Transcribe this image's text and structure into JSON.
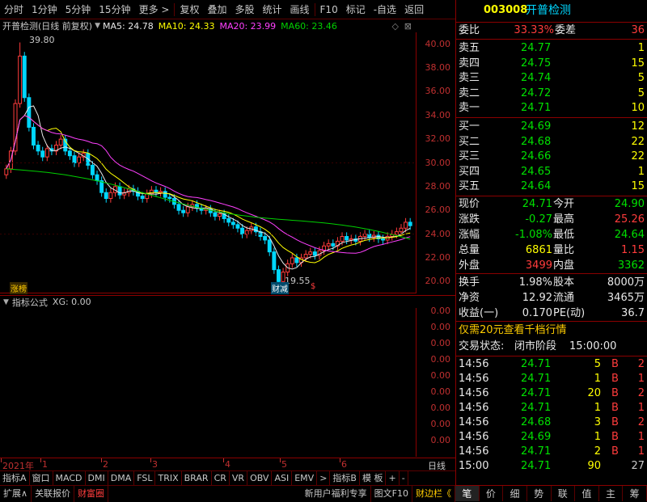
{
  "toolbar": {
    "items": [
      "分时",
      "1分钟",
      "5分钟",
      "15分钟",
      "更多 >",
      "复权",
      "叠加",
      "多股",
      "统计",
      "画线",
      "F10",
      "标记",
      "-自选",
      "返回"
    ]
  },
  "chart": {
    "stock_name": "开普检测",
    "mode": "(日线 前复权)",
    "ma5": "MA5: 24.78",
    "ma10": "MA10: 24.33",
    "ma20": "MA20: 23.99",
    "ma60": "MA60: 23.46",
    "high_mark": "39.80",
    "low_mark": "19.55",
    "tag_left": "涨榜",
    "tag_mid": "财减",
    "tag_s": "$"
  },
  "colors": {
    "ma5": "#e8e8e8",
    "ma10": "#ffff00",
    "ma20": "#ff40ff",
    "ma60": "#00d000",
    "up": "#ff3c3c",
    "down": "#00d7ff"
  },
  "chart_data": {
    "type": "candlestick",
    "ylim": [
      19,
      41
    ],
    "yticks": [
      "40.00",
      "38.00",
      "36.00",
      "34.00",
      "32.00",
      "30.00",
      "28.00",
      "26.00",
      "24.00",
      "22.00",
      "20.00"
    ],
    "close": [
      29.5,
      31.0,
      35.0,
      39.0,
      35.5,
      33.0,
      31.5,
      31.0,
      30.5,
      31.2,
      31.0,
      31.5,
      32.0,
      31.0,
      30.6,
      30.0,
      30.5,
      30.8,
      29.8,
      29.0,
      28.5,
      27.5,
      27.0,
      27.5,
      28.0,
      27.3,
      27.5,
      27.8,
      27.6,
      27.2,
      27.0,
      27.4,
      27.7,
      27.5,
      27.6,
      27.1,
      27.0,
      26.5,
      26.0,
      25.8,
      26.3,
      26.5,
      26.2,
      26.0,
      26.1,
      25.8,
      25.5,
      25.7,
      25.3,
      25.0,
      24.8,
      24.5,
      24.0,
      24.3,
      24.6,
      24.2,
      23.8,
      23.5,
      22.5,
      21.0,
      20.0,
      20.8,
      21.5,
      22.0,
      21.6,
      22.0,
      22.3,
      22.5,
      22.2,
      22.6,
      23.0,
      23.2,
      23.0,
      23.4,
      23.8,
      23.5,
      23.6,
      23.4,
      23.8,
      24.0,
      23.7,
      23.9,
      23.6,
      23.5,
      23.8,
      24.0,
      24.2,
      24.5,
      25.0,
      24.71
    ],
    "ma_last": {
      "ma5": 24.78,
      "ma10": 24.33,
      "ma20": 23.99,
      "ma60": 23.46
    }
  },
  "indicator": {
    "title": "指标公式",
    "xg": "XG: 0.00",
    "ticks": [
      "0.00",
      "0.00",
      "0.00",
      "0.00",
      "0.00",
      "0.00",
      "0.00",
      "0.00",
      "0.00"
    ]
  },
  "timeaxis": {
    "labels": [
      "2021年",
      "1",
      "2",
      "3",
      "4",
      "5",
      "6"
    ],
    "right": "日线"
  },
  "tabs": [
    "指标A",
    "窗口",
    "MACD",
    "DMI",
    "DMA",
    "FSL",
    "TRIX",
    "BRAR",
    "CR",
    "VR",
    "OBV",
    "ASI",
    "EMV",
    ">",
    "指标B",
    "模 板",
    "+",
    "-"
  ],
  "bottom": {
    "items": [
      "扩展∧",
      "关联报价",
      "财富圈"
    ],
    "right": [
      "新用户福利专享",
      "图文F10",
      "财边栏《"
    ]
  },
  "quote": {
    "code": "003008",
    "name": "开普检测",
    "weibi_label": "委比",
    "weibi_value": "33.33%",
    "weicha_label": "委差",
    "weicha_value": "36",
    "sells": [
      {
        "label": "卖五",
        "price": "24.77",
        "vol": "1"
      },
      {
        "label": "卖四",
        "price": "24.75",
        "vol": "15"
      },
      {
        "label": "卖三",
        "price": "24.74",
        "vol": "5"
      },
      {
        "label": "卖二",
        "price": "24.72",
        "vol": "5"
      },
      {
        "label": "卖一",
        "price": "24.71",
        "vol": "10"
      }
    ],
    "buys": [
      {
        "label": "买一",
        "price": "24.69",
        "vol": "12"
      },
      {
        "label": "买二",
        "price": "24.68",
        "vol": "22"
      },
      {
        "label": "买三",
        "price": "24.66",
        "vol": "22"
      },
      {
        "label": "买四",
        "price": "24.65",
        "vol": "1"
      },
      {
        "label": "买五",
        "price": "24.64",
        "vol": "15"
      }
    ],
    "stats": [
      {
        "l1": "现价",
        "v1": "24.71",
        "l2": "今开",
        "v2": "24.90"
      },
      {
        "l1": "涨跌",
        "v1": "-0.27",
        "l2": "最高",
        "v2": "25.26"
      },
      {
        "l1": "涨幅",
        "v1": "-1.08%",
        "l2": "最低",
        "v2": "24.64"
      },
      {
        "l1": "总量",
        "v1": "6861",
        "l2": "量比",
        "v2": "1.15"
      },
      {
        "l1": "外盘",
        "v1": "3499",
        "l2": "内盘",
        "v2": "3362"
      }
    ],
    "stats2": [
      {
        "l1": "换手",
        "v1": "1.98%",
        "l2": "股本",
        "v2": "8000万"
      },
      {
        "l1": "净资",
        "v1": "12.92",
        "l2": "流通",
        "v2": "3465万"
      },
      {
        "l1": "收益(一)",
        "v1": "0.170",
        "l2": "PE(动)",
        "v2": "36.7"
      }
    ],
    "promo": "仅需20元查看千档行情",
    "status_label": "交易状态:",
    "status_value": "闭市阶段",
    "status_time": "15:00:00",
    "ticks": [
      {
        "t": "14:56",
        "p": "24.71",
        "v": "5",
        "d": "B",
        "n": "2"
      },
      {
        "t": "14:56",
        "p": "24.71",
        "v": "1",
        "d": "B",
        "n": "1"
      },
      {
        "t": "14:56",
        "p": "24.71",
        "v": "20",
        "d": "B",
        "n": "2"
      },
      {
        "t": "14:56",
        "p": "24.71",
        "v": "1",
        "d": "B",
        "n": "1"
      },
      {
        "t": "14:56",
        "p": "24.68",
        "v": "3",
        "d": "B",
        "n": "2"
      },
      {
        "t": "14:56",
        "p": "24.69",
        "v": "1",
        "d": "B",
        "n": "1"
      },
      {
        "t": "14:56",
        "p": "24.71",
        "v": "2",
        "d": "B",
        "n": "1"
      },
      {
        "t": "15:00",
        "p": "24.71",
        "v": "90",
        "d": "",
        "n": "27"
      }
    ],
    "tabs": [
      "笔",
      "价",
      "细",
      "势",
      "联",
      "值",
      "主",
      "筹"
    ]
  }
}
